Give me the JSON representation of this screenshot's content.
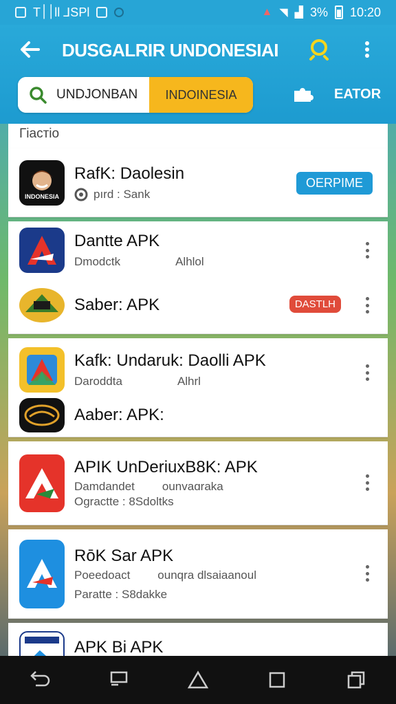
{
  "status_bar": {
    "left_text": "T׀׀ll ⅃SPl",
    "time": "10:20",
    "battery_text": "3%"
  },
  "header": {
    "title": "DUSGALRIR UNDONESIAI"
  },
  "tabs": {
    "left": "UNDJONBAN",
    "right": "INDOINESIA",
    "ext_label": "EATOR"
  },
  "section_title": "Гіастіо",
  "apps": [
    {
      "name": "RafK: Daolesin",
      "sub1": "pırd : Sank",
      "badge": "OERPIME",
      "badge_color": "#1f9ad6",
      "icon_text": "INDONESIA"
    },
    {
      "name": "Dantte APK",
      "sub1": "Dmodctk",
      "sub2": "Alhlol"
    },
    {
      "name": "Saber: APK",
      "badge": "DASTLH",
      "badge_color": "#e04b3a"
    },
    {
      "name": "Kafk: Undaruk: Daolli APK",
      "sub1": "Daroddta",
      "sub2": "Alhrl"
    },
    {
      "name": "Aaber: APK:"
    },
    {
      "name": "APIK UnDeriuxB8K: APK",
      "sub1": "Damdandet",
      "sub2": "ounvaɑraka",
      "sub3": "Ogractte : 8Sdoltks"
    },
    {
      "name": "RōK Sar APK",
      "sub1": "Poeedoact",
      "sub2": "ounqra dlsaiaanoul",
      "sub3": "Paratte : S8dakke"
    },
    {
      "name": "APK Bi APK"
    }
  ]
}
